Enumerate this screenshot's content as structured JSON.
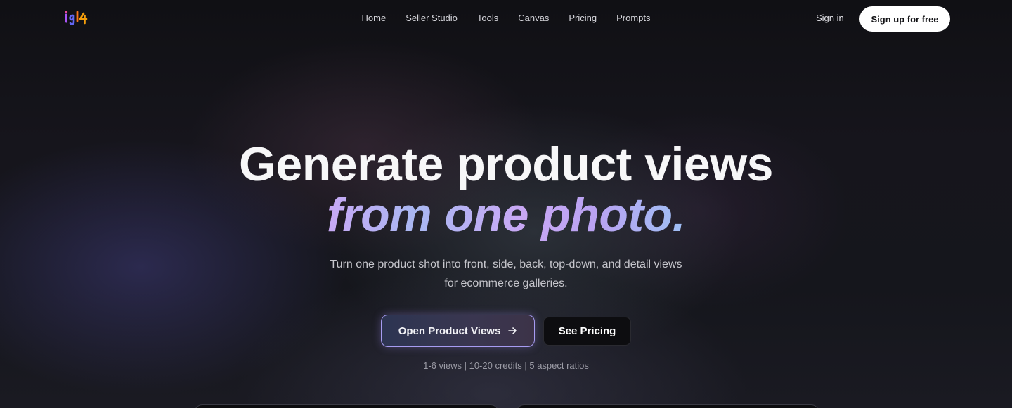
{
  "brand": {
    "logo_text": "igl4",
    "logo_colors": [
      "#a855f7",
      "#ec4899",
      "#3b82f6",
      "#f97316"
    ]
  },
  "nav": {
    "links": [
      {
        "label": "Home"
      },
      {
        "label": "Seller Studio"
      },
      {
        "label": "Tools"
      },
      {
        "label": "Canvas"
      },
      {
        "label": "Pricing"
      },
      {
        "label": "Prompts"
      }
    ],
    "sign_in": "Sign in",
    "sign_up": "Sign up for free"
  },
  "hero": {
    "title_line1": "Generate product views",
    "title_line2": "from one photo.",
    "subtitle_line1": "Turn one product shot into front, side, back, top-down, and detail views",
    "subtitle_line2": "for ecommerce galleries.",
    "primary_cta": "Open Product Views",
    "primary_cta_icon": "arrow-right-icon",
    "secondary_cta": "See Pricing",
    "meta": "1-6 views | 10-20 credits | 5 aspect ratios"
  },
  "colors": {
    "accent_border": "#a79cf2",
    "gradient_start": "#c7a8f5",
    "gradient_end": "#9fc0f5"
  }
}
